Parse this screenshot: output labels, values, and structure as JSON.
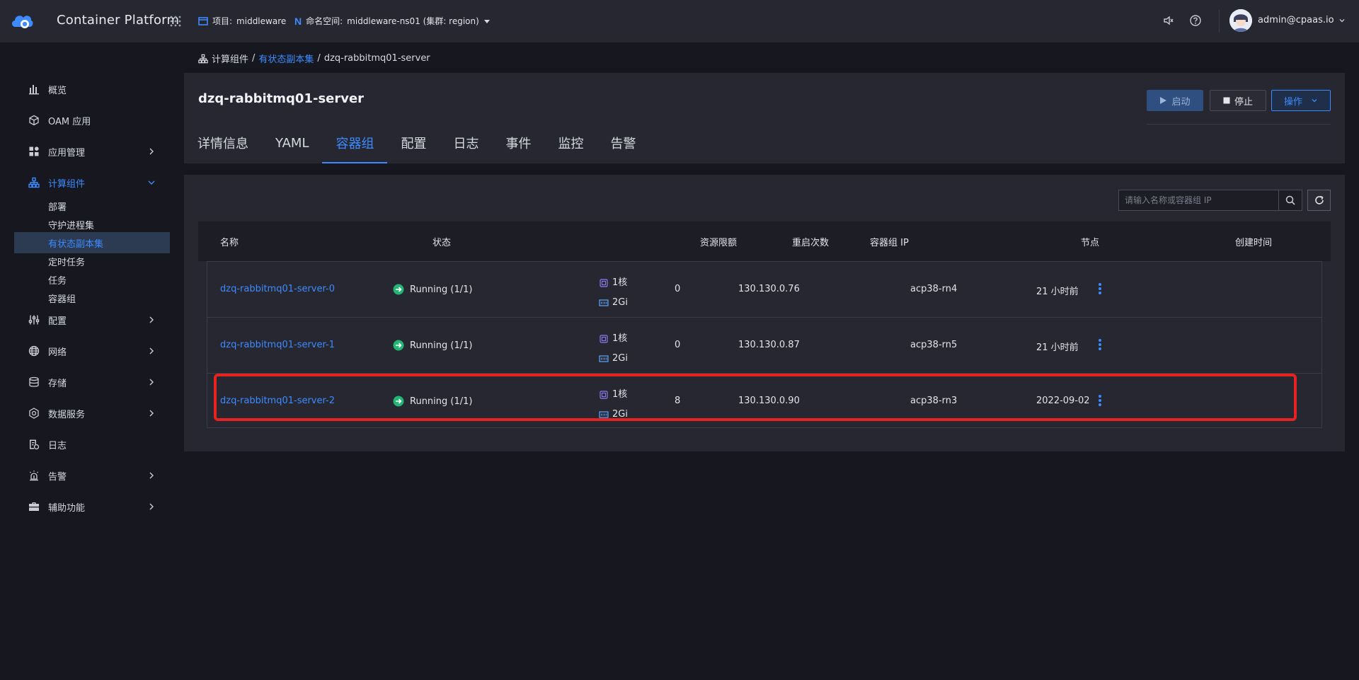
{
  "topbar": {
    "brand": "Container Platform",
    "project_label": "项目:",
    "project_value": "middleware",
    "namespace_label": "命名空间:",
    "namespace_value": "middleware-ns01 (集群: region)",
    "user": "admin@cpaas.io"
  },
  "sidebar": {
    "items": [
      {
        "label": "概览",
        "icon": "bar-chart-icon"
      },
      {
        "label": "OAM 应用",
        "icon": "cube-icon"
      },
      {
        "label": "应用管理",
        "icon": "apps-icon"
      },
      {
        "label": "计算组件",
        "icon": "hierarchy-icon"
      },
      {
        "label": "配置",
        "icon": "sliders-icon"
      },
      {
        "label": "网络",
        "icon": "globe-icon"
      },
      {
        "label": "存储",
        "icon": "database-icon"
      },
      {
        "label": "数据服务",
        "icon": "hexagon-icon"
      },
      {
        "label": "日志",
        "icon": "log-icon"
      },
      {
        "label": "告警",
        "icon": "alarm-icon"
      },
      {
        "label": "辅助功能",
        "icon": "toolbox-icon"
      }
    ],
    "compute_sub": [
      "部署",
      "守护进程集",
      "有状态副本集",
      "定时任务",
      "任务",
      "容器组"
    ]
  },
  "breadcrumb": {
    "root": "计算组件",
    "sep": "/",
    "parent": "有状态副本集",
    "current": "dzq-rabbitmq01-server"
  },
  "header": {
    "title": "dzq-rabbitmq01-server",
    "start_label": "启动",
    "stop_label": "停止",
    "ops_label": "操作",
    "tabs": [
      "详情信息",
      "YAML",
      "容器组",
      "配置",
      "日志",
      "事件",
      "监控",
      "告警"
    ],
    "active_tab": "容器组"
  },
  "toolbar": {
    "search_placeholder": "请输入名称或容器组 IP"
  },
  "table": {
    "headers": {
      "name": "名称",
      "status": "状态",
      "resources": "资源限额",
      "restarts": "重启次数",
      "ip": "容器组 IP",
      "node": "节点",
      "created": "创建时间"
    },
    "rows": [
      {
        "name": "dzq-rabbitmq01-server-0",
        "status": "Running (1/1)",
        "cpu": "1核",
        "mem": "2Gi",
        "restarts": "0",
        "ip": "130.130.0.76",
        "node": "acp38-rn4",
        "created": "21 小时前"
      },
      {
        "name": "dzq-rabbitmq01-server-1",
        "status": "Running (1/1)",
        "cpu": "1核",
        "mem": "2Gi",
        "restarts": "0",
        "ip": "130.130.0.87",
        "node": "acp38-rn5",
        "created": "21 小时前"
      },
      {
        "name": "dzq-rabbitmq01-server-2",
        "status": "Running (1/1)",
        "cpu": "1核",
        "mem": "2Gi",
        "restarts": "8",
        "ip": "130.130.0.90",
        "node": "acp38-rn3",
        "created": "2022-09-02"
      }
    ]
  },
  "colors": {
    "accent": "#3d8bff",
    "running": "#22b573",
    "highlight": "#e8231f",
    "bg": "#17181f",
    "panel": "#262731"
  }
}
